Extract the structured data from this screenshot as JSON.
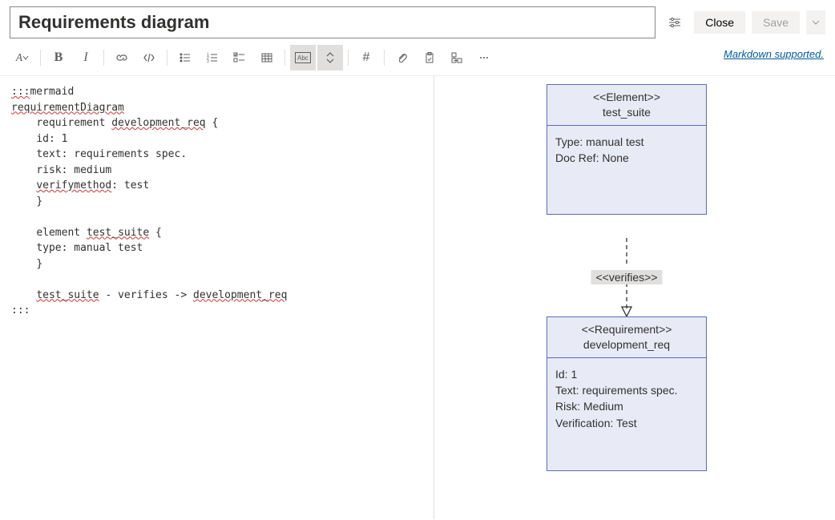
{
  "header": {
    "title_value": "Requirements diagram",
    "close_label": "Close",
    "save_label": "Save"
  },
  "toolbar": {
    "markdown_link": "Markdown supported."
  },
  "editor": {
    "line1": ":::",
    "line1b": "mermaid",
    "line2": "requirementDiagram",
    "indent": "    ",
    "req_kw": "requirement ",
    "req_name": "development_req",
    "brace_open": " {",
    "id_line": "id: 1",
    "text_line": "text: requirements spec.",
    "risk_line": "risk: medium",
    "verify_kw": "verifymethod",
    "verify_rest": ": test",
    "brace_close": "}",
    "elem_kw": "element ",
    "elem_name": "test_suite",
    "type_line": "type: manual test",
    "rel_left": "test_suite",
    "rel_mid": " - verifies -> ",
    "rel_right": "development_req",
    "line_end": ":::"
  },
  "diagram": {
    "node1": {
      "stereo": "<<Element>>",
      "name": "test_suite",
      "body_l1": "Type: manual test",
      "body_l2": "Doc Ref: None"
    },
    "edge_label": "<<verifies>>",
    "node2": {
      "stereo": "<<Requirement>>",
      "name": "development_req",
      "body_l1": "Id: 1",
      "body_l2": "Text: requirements spec.",
      "body_l3": "Risk: Medium",
      "body_l4": "Verification: Test"
    }
  }
}
